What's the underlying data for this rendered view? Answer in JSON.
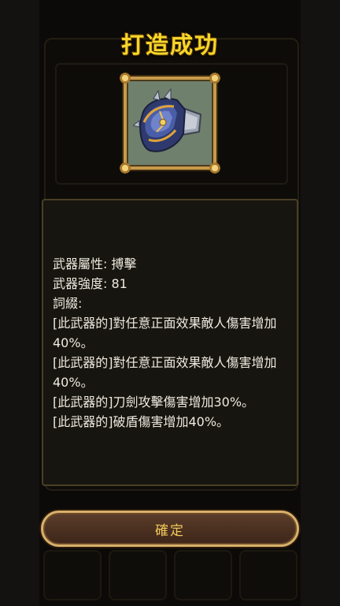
{
  "dialog": {
    "title": "打造成功",
    "item_icon": "gauntlet-weapon-icon",
    "attributes": [
      "武器屬性:  搏擊",
      "武器強度:   81",
      "詞綴:"
    ],
    "affixes": [
      "[此武器的]對任意正面效果敵人傷害增加40%。",
      "[此武器的]對任意正面效果敵人傷害增加40%。",
      "[此武器的]刀劍攻擊傷害增加30%。",
      "[此武器的]破盾傷害增加40%。"
    ],
    "confirm_label": "確定"
  },
  "colors": {
    "title": "#f7d62a",
    "button_text": "#f0c95a",
    "button_border": "#d8b069",
    "panel_bg": "#17150f",
    "frame_gold": "#c79a4a"
  }
}
